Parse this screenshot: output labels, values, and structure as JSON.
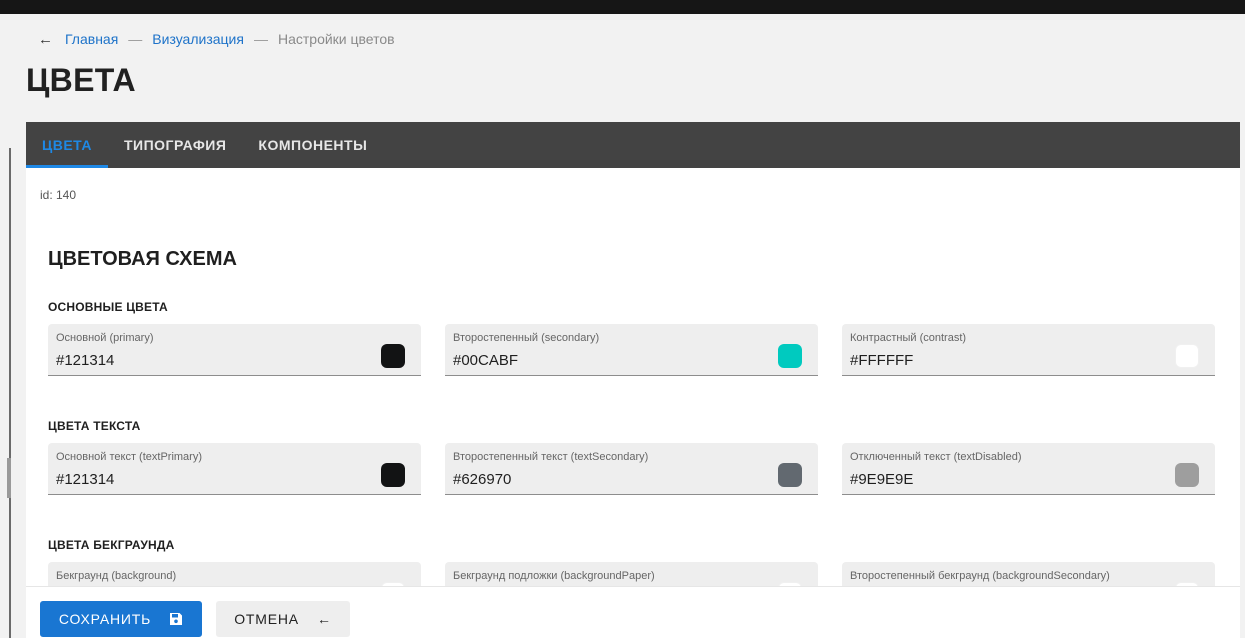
{
  "breadcrumb": {
    "home": "Главная",
    "section": "Визуализация",
    "current": "Настройки цветов",
    "separator": "—",
    "back_icon": "arrow-left-icon"
  },
  "page": {
    "title": "ЦВЕТА"
  },
  "tabs": [
    {
      "label": "ЦВЕТА",
      "active": true
    },
    {
      "label": "ТИПОГРАФИЯ",
      "active": false
    },
    {
      "label": "КОМПОНЕНТЫ",
      "active": false
    }
  ],
  "record": {
    "id_text": "id: 140"
  },
  "scheme": {
    "title": "ЦВЕТОВАЯ СХЕМА",
    "groups": [
      {
        "title": "ОСНОВНЫЕ ЦВЕТА",
        "fields": [
          {
            "label": "Основной (primary)",
            "value": "#121314",
            "swatch": "#121314"
          },
          {
            "label": "Второстепенный (secondary)",
            "value": "#00CABF",
            "swatch": "#00CABF"
          },
          {
            "label": "Контрастный (contrast)",
            "value": "#FFFFFF",
            "swatch": "#FFFFFF"
          }
        ]
      },
      {
        "title": "ЦВЕТА ТЕКСТА",
        "fields": [
          {
            "label": "Основной текст (textPrimary)",
            "value": "#121314",
            "swatch": "#121314"
          },
          {
            "label": "Второстепенный текст (textSecondary)",
            "value": "#626970",
            "swatch": "#626970"
          },
          {
            "label": "Отключенный текст (textDisabled)",
            "value": "#9E9E9E",
            "swatch": "#9E9E9E"
          }
        ]
      },
      {
        "title": "ЦВЕТА БЕКГРАУНДА",
        "fields": [
          {
            "label": "Бекграунд (background)",
            "value": "",
            "swatch": "#FFFFFF"
          },
          {
            "label": "Бекграунд подложки (backgroundPaper)",
            "value": "",
            "swatch": "#FFFFFF"
          },
          {
            "label": "Второстепенный бекграунд (backgroundSecondary)",
            "value": "",
            "swatch": "#FFFFFF"
          }
        ]
      }
    ]
  },
  "actions": {
    "save_label": "СОХРАНИТЬ",
    "save_icon": "floppy-disk-icon",
    "cancel_label": "ОТМЕНА",
    "cancel_icon": "arrow-left-icon"
  },
  "colors": {
    "accent": "#1976D2",
    "link": "#1E73C9",
    "tabbar": "#434343"
  }
}
